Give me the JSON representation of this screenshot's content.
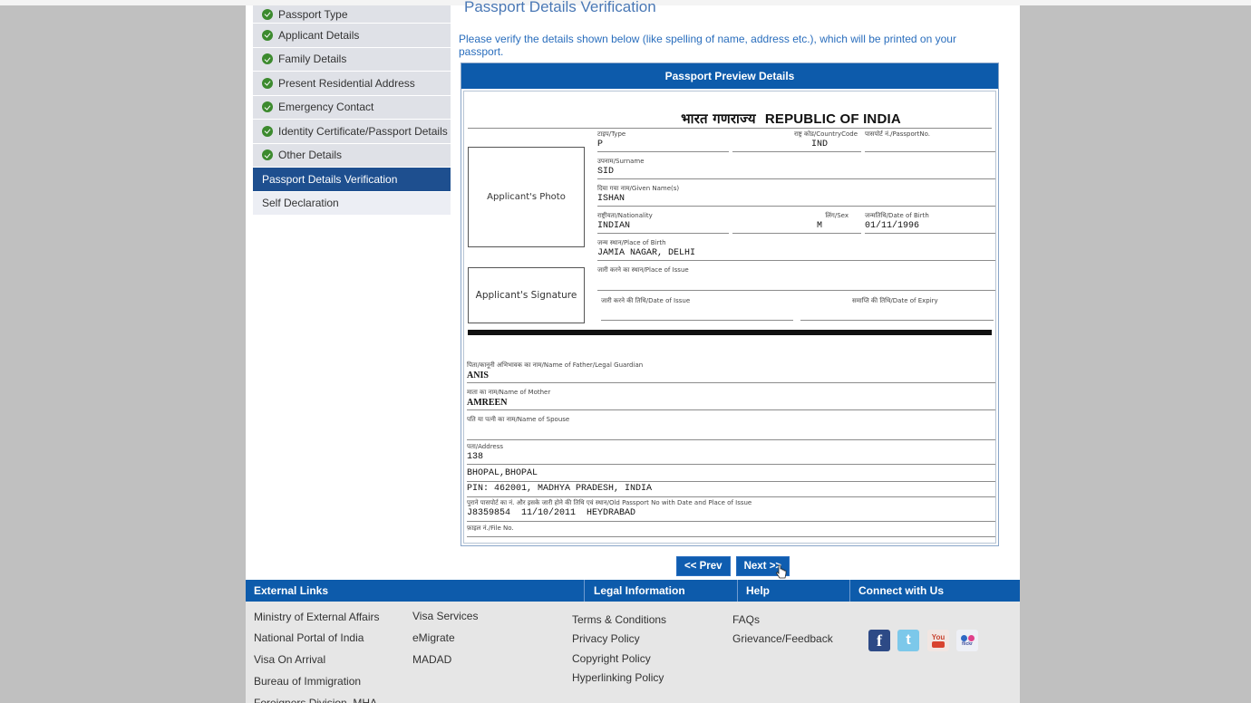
{
  "sidebar": {
    "items": [
      {
        "label": "Passport Type",
        "status": "done"
      },
      {
        "label": "Applicant Details",
        "status": "done"
      },
      {
        "label": "Family Details",
        "status": "done"
      },
      {
        "label": "Present Residential Address",
        "status": "done"
      },
      {
        "label": "Emergency Contact",
        "status": "done"
      },
      {
        "label": "Identity Certificate/Passport Details",
        "status": "done"
      },
      {
        "label": "Other Details",
        "status": "done"
      },
      {
        "label": "Passport Details Verification",
        "status": "active"
      },
      {
        "label": "Self Declaration",
        "status": "pending"
      }
    ]
  },
  "main": {
    "title": "Passport Details Verification",
    "intro": "Please verify the details shown below (like spelling of name, address etc.), which will be printed on your passport.",
    "preview_header": "Passport Preview Details",
    "republic_hindi": "भारत गणराज्य",
    "republic_english": "REPUBLIC OF INDIA",
    "photo_placeholder": "Applicant's Photo",
    "signature_placeholder": "Applicant's Signature",
    "fields": {
      "type": {
        "label": "टाइप/Type",
        "value": "P"
      },
      "country_code": {
        "label": "राष्ट्र कोड/CountryCode",
        "value": "IND"
      },
      "passport_no": {
        "label": "पासपोर्ट नं./PassportNo.",
        "value": ""
      },
      "surname": {
        "label": "उपनाम/Surname",
        "value": "SID"
      },
      "given_names": {
        "label": "दिया गया नाम/Given Name(s)",
        "value": "ISHAN"
      },
      "nationality": {
        "label": "राष्ट्रीयता/Nationality",
        "value": "INDIAN"
      },
      "sex": {
        "label": "लिंग/Sex",
        "value": "M"
      },
      "dob": {
        "label": "जन्मतिथि/Date of Birth",
        "value": "01/11/1996"
      },
      "place_of_birth": {
        "label": "जन्म स्थान/Place of Birth",
        "value": "JAMIA NAGAR, DELHI"
      },
      "place_of_issue": {
        "label": "जारी करने का स्थान/Place of Issue",
        "value": ""
      },
      "date_of_issue": {
        "label": "जारी करने की तिथि/Date of Issue",
        "value": ""
      },
      "date_of_expiry": {
        "label": "समाप्ति की तिथि/Date of Expiry",
        "value": ""
      },
      "father": {
        "label": "पिता/कानूनी अभिभावक का नाम/Name of Father/Legal Guardian",
        "value": "ANIS"
      },
      "mother": {
        "label": "माता का नाम/Name of Mother",
        "value": "AMREEN"
      },
      "spouse": {
        "label": "पति या पत्नी का नाम/Name of Spouse",
        "value": ""
      },
      "address": {
        "label": "पता/Address",
        "line1": "138",
        "line2": "BHOPAL,BHOPAL",
        "line3": "PIN: 462001, MADHYA PRADESH, INDIA"
      },
      "old_passport": {
        "label": "पुराने पासपोर्ट का नं. और इसके जारी होने की तिथि एवं स्थान/Old Passport No with Date and Place of Issue",
        "value": "J8359854  11/10/2011  HEYDRABAD"
      },
      "file_no": {
        "label": "फ़ाइल नं./File No.",
        "value": ""
      }
    }
  },
  "buttons": {
    "prev": "<< Prev",
    "next": "Next >>"
  },
  "footer": {
    "headers": {
      "external": "External Links",
      "legal": "Legal Information",
      "help": "Help",
      "connect": "Connect with Us"
    },
    "external_col1": [
      "Ministry of External Affairs",
      "National Portal of India",
      "Visa On Arrival",
      "Bureau of Immigration",
      "Foreigners Division, MHA"
    ],
    "external_col2": [
      "Visa Services",
      "eMigrate",
      "MADAD"
    ],
    "legal": [
      "Terms & Conditions",
      "Privacy Policy",
      "Copyright Policy",
      "Hyperlinking Policy"
    ],
    "help": [
      "FAQs",
      "Grievance/Feedback"
    ],
    "social": [
      {
        "icon": "facebook-icon",
        "glyph": "f",
        "color": "#2d4a86"
      },
      {
        "icon": "twitter-icon",
        "glyph": "t",
        "color": "#6fc3e8"
      },
      {
        "icon": "youtube-icon",
        "glyph": "You",
        "color": "#d8432f"
      },
      {
        "icon": "flickr-icon",
        "glyph": "flickr",
        "color": "#e8e8f0"
      }
    ]
  }
}
